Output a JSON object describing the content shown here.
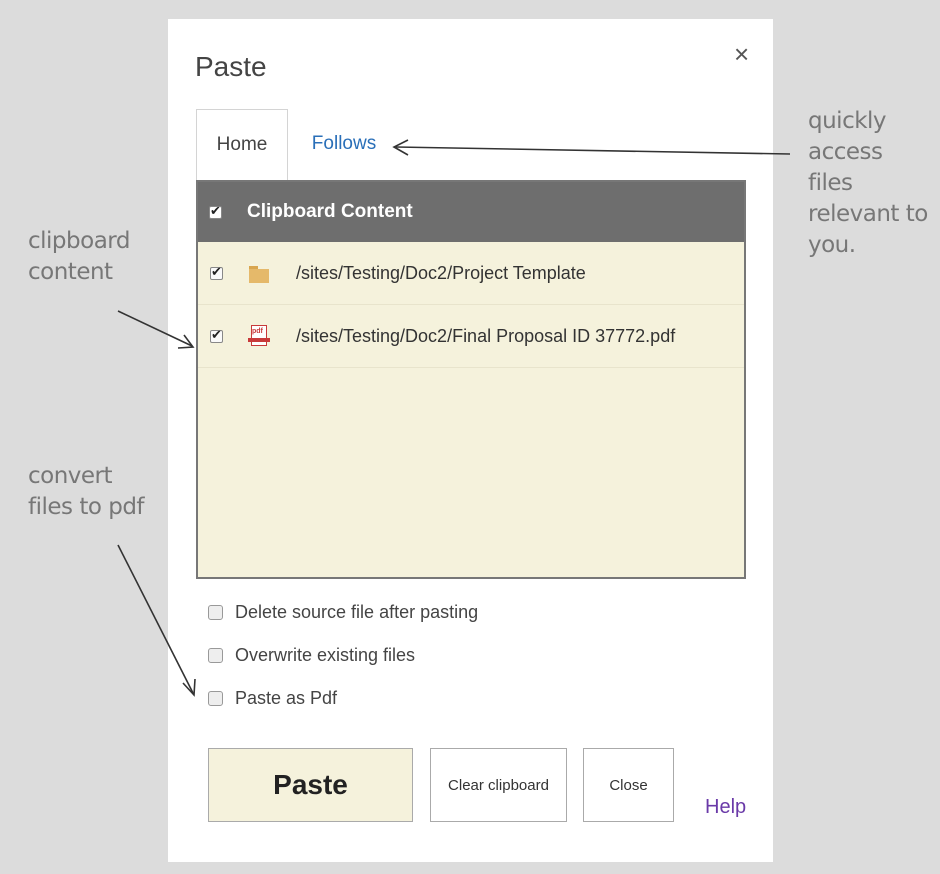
{
  "dialog": {
    "title": "Paste",
    "close_symbol": "×"
  },
  "tabs": [
    {
      "label": "Home",
      "active": true
    },
    {
      "label": "Follows",
      "active": false
    }
  ],
  "clipboard": {
    "header_label": "Clipboard Content",
    "header_checked": true,
    "items": [
      {
        "path": "/sites/Testing/Doc2/Project Template",
        "icon": "folder-icon",
        "checked": true
      },
      {
        "path": "/sites/Testing/Doc2/Final Proposal ID 37772.pdf",
        "icon": "pdf-icon",
        "checked": true
      }
    ]
  },
  "options": [
    {
      "label": "Delete source file after pasting",
      "checked": false
    },
    {
      "label": "Overwrite existing files",
      "checked": false
    },
    {
      "label": "Paste as Pdf",
      "checked": false
    }
  ],
  "buttons": {
    "paste": "Paste",
    "clear": "Clear clipboard",
    "close": "Close",
    "help": "Help"
  },
  "annotations": {
    "quick": "quickly\naccess\nfiles\nrelevant to\nyou.",
    "clipboard": "clipboard\ncontent",
    "convert": "convert\nfiles to pdf"
  },
  "colors": {
    "panel_bg": "#f5f2dc",
    "header_bg": "#6e6e6e",
    "link": "#2a6fb8",
    "help": "#6a3aa8"
  }
}
